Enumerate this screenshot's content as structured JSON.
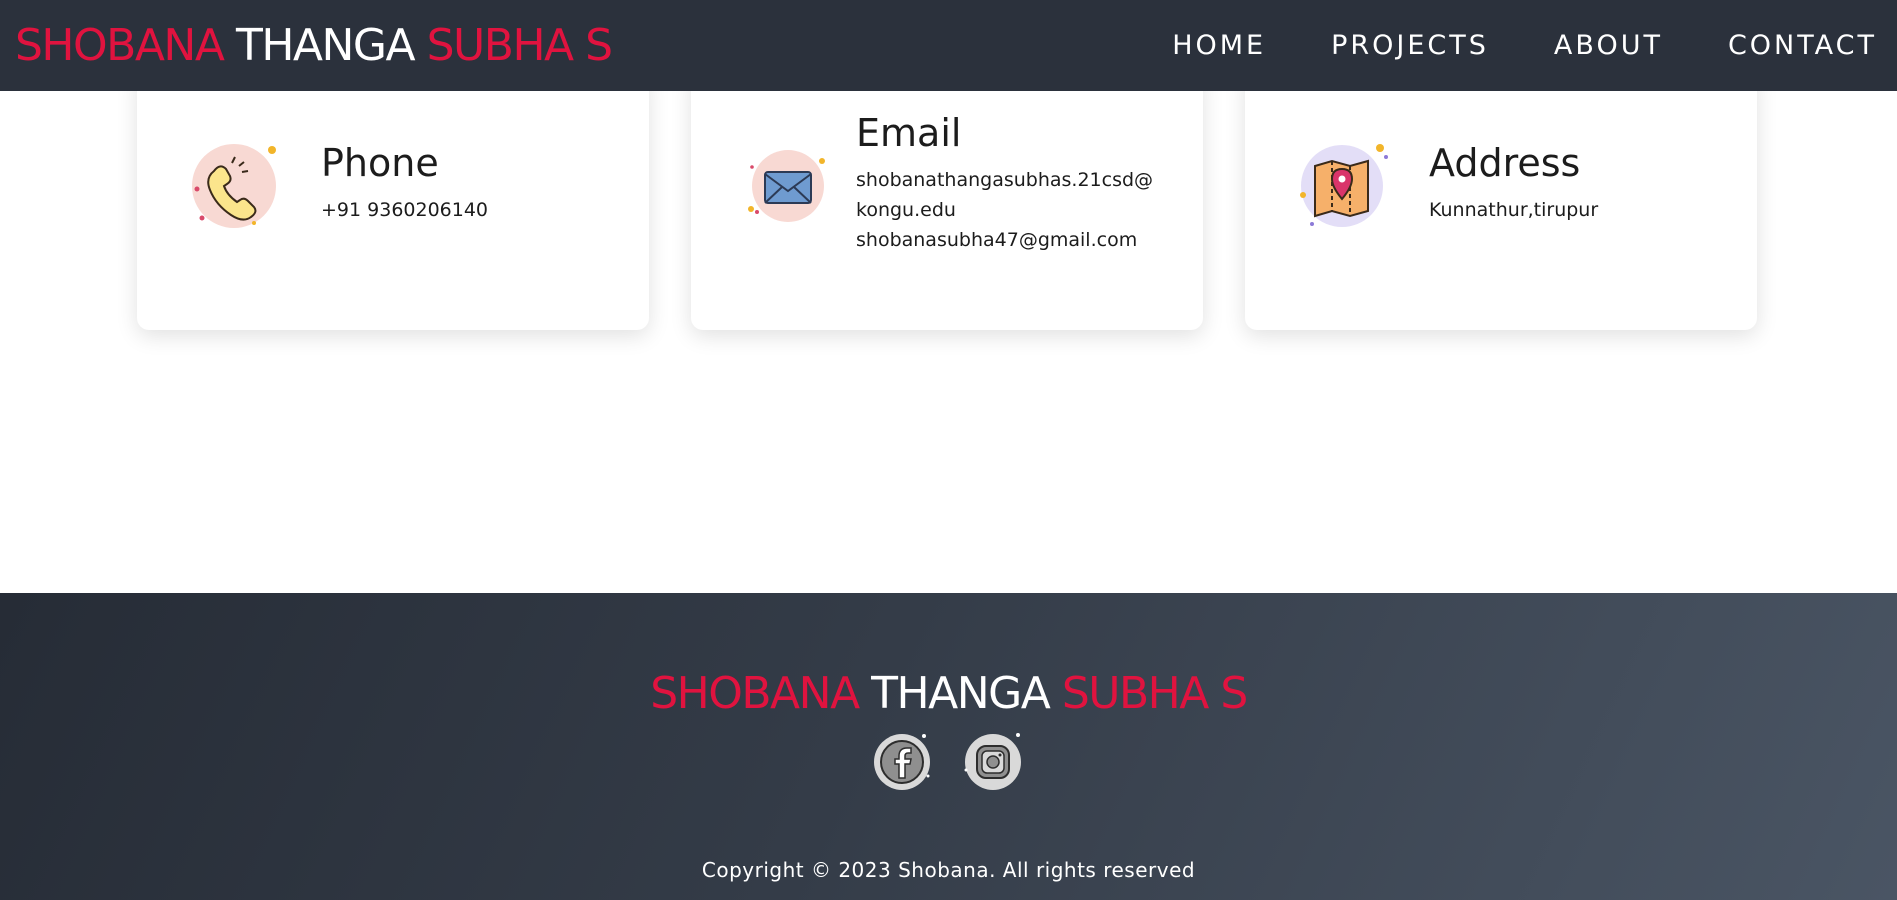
{
  "nav": {
    "logo": {
      "first": "SHOBANA",
      "middle": "THANGA",
      "last": "SUBHA S"
    },
    "links": [
      "HOME",
      "PROJECTS",
      "ABOUT",
      "CONTACT"
    ]
  },
  "contact": {
    "cards": [
      {
        "title": "Phone",
        "lines": [
          "+91 9360206140"
        ],
        "icon": "phone-icon"
      },
      {
        "title": "Email",
        "lines": [
          "shobanathangasubhas.21csd@",
          "kongu.edu",
          "shobanasubha47@gmail.com"
        ],
        "icon": "envelope-icon"
      },
      {
        "title": "Address",
        "lines": [
          "Kunnathur,tirupur"
        ],
        "icon": "map-pin-icon"
      }
    ]
  },
  "footer": {
    "logo": {
      "first": "SHOBANA",
      "middle": "THANGA",
      "last": "SUBHA S"
    },
    "social": [
      "facebook-icon",
      "instagram-icon"
    ],
    "copyright": "Copyright © 2023 Shobana. All rights reserved"
  },
  "colors": {
    "accent": "#e0133f",
    "navbar": "#2b313c",
    "text": "#1c1c1c"
  }
}
